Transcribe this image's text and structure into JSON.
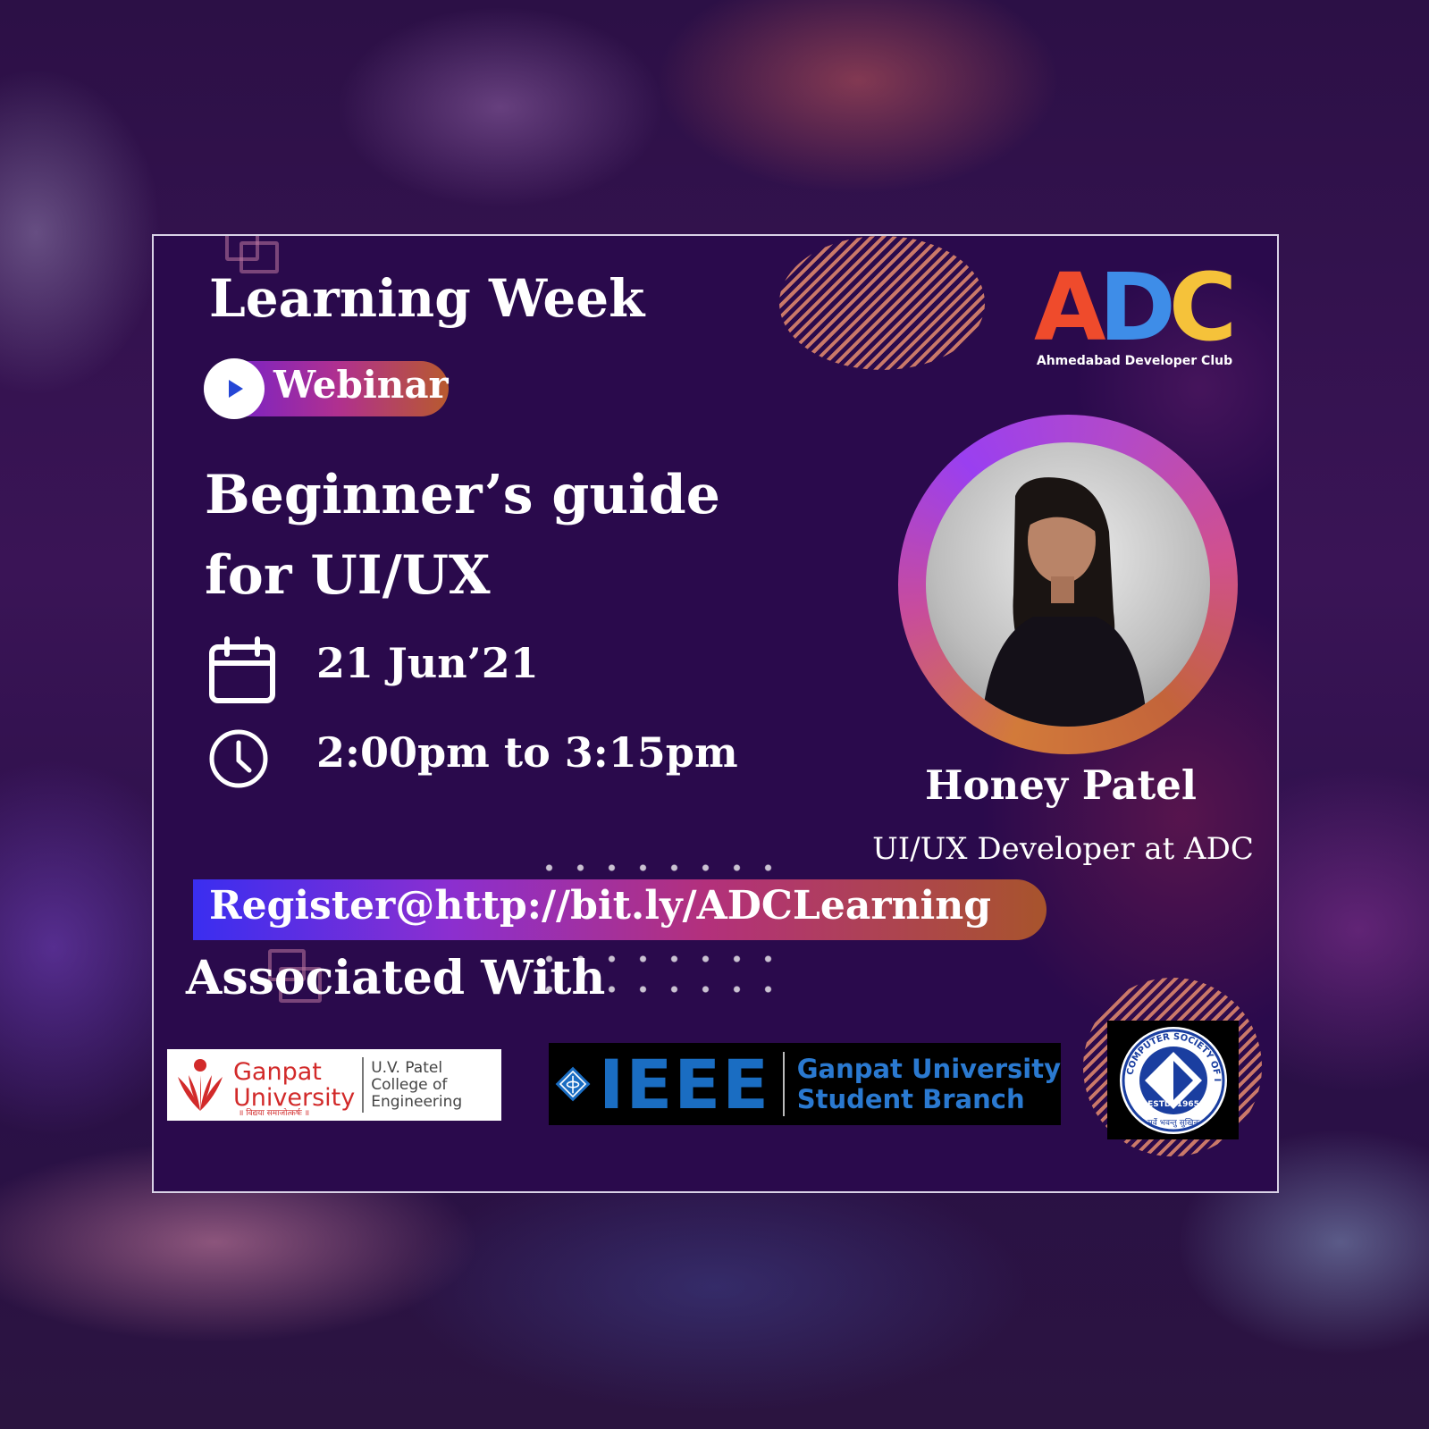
{
  "poster": {
    "series_title": "Learning Week",
    "event_type": "Webinar",
    "topic": "Beginner’s guide for UI/UX",
    "date": "21 Jun’21",
    "time": "2:00pm to 3:15pm",
    "register_text": "Register@http://bit.ly/ADCLearning",
    "associated_heading": "Associated With"
  },
  "organizer": {
    "logo_letters": [
      "A",
      "D",
      "C"
    ],
    "logo_subtitle": "Ahmedabad Developer Club",
    "colors": {
      "a": "#ef4b2c",
      "d": "#3e8de8",
      "c": "#f5c23a"
    }
  },
  "speaker": {
    "name": "Honey Patel",
    "role": "UI/UX Developer at ADC"
  },
  "partners": {
    "ganpat": {
      "name_line1": "Ganpat",
      "name_line2": "University",
      "college_line1": "U.V. Patel",
      "college_line2": "College of",
      "college_line3": "Engineering",
      "motto": "॥ विद्यया समाजोत्कर्षः ॥"
    },
    "ieee": {
      "wordmark": "IEEE",
      "branch_line1": "Ganpat University",
      "branch_line2": "Student Branch"
    },
    "csi": {
      "ring_text": "COMPUTER SOCIETY OF INDIA",
      "established": "ESTD. 1965",
      "motto": "सर्वे भवन्तु सुखिनः"
    }
  },
  "icons": {
    "play": "play-icon",
    "calendar": "calendar-icon",
    "clock": "clock-icon"
  },
  "theme": {
    "background": "#2a0a4c",
    "accent_purple": "#6a1fd6",
    "accent_magenta": "#b0308f",
    "accent_orange": "#b85a2e"
  }
}
